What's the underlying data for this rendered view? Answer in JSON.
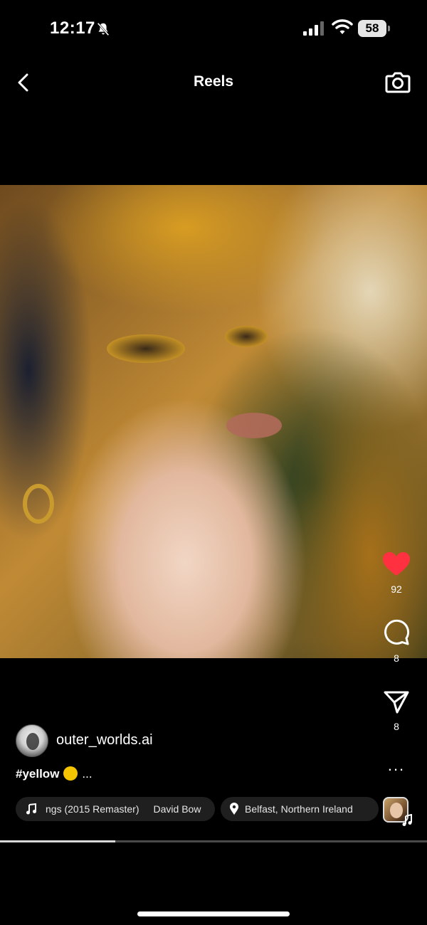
{
  "status_bar": {
    "time": "12:17",
    "battery": "58"
  },
  "header": {
    "title": "Reels"
  },
  "actions": {
    "likes": "92",
    "comments": "8",
    "shares": "8",
    "more": "..."
  },
  "post": {
    "username": "outer_worlds.ai",
    "caption": "#yellow",
    "caption_more": "...",
    "music_title": "ngs (2015 Remaster)",
    "music_artist": "David Bow",
    "location": "Belfast, Northern Ireland"
  },
  "playback": {
    "progress": 0.27
  },
  "colors": {
    "like": "#ff3040",
    "background": "#000000",
    "pill": "#1f1f1f"
  }
}
